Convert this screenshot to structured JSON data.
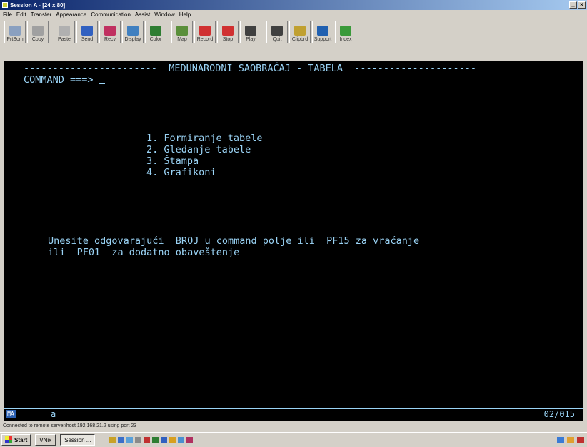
{
  "window": {
    "title": "Session A - [24 x 80]",
    "min_glyph": "_",
    "close_glyph": "×"
  },
  "menu": [
    "File",
    "Edit",
    "Transfer",
    "Appearance",
    "Communication",
    "Assist",
    "Window",
    "Help"
  ],
  "toolbar": [
    {
      "label": "PrtScrn",
      "icon": "print-screen-icon",
      "color": "#8aa0c0"
    },
    {
      "label": "Copy",
      "icon": "copy-icon",
      "color": "#a0a0a0"
    },
    {
      "label": "Paste",
      "icon": "paste-icon",
      "color": "#b0b0b0"
    },
    {
      "label": "Send",
      "icon": "send-icon",
      "color": "#3060c0"
    },
    {
      "label": "Recv",
      "icon": "receive-icon",
      "color": "#c03060"
    },
    {
      "label": "Display",
      "icon": "display-icon",
      "color": "#4080c0"
    },
    {
      "label": "Color",
      "icon": "color-icon",
      "color": "#2e7d32"
    },
    {
      "label": "Map",
      "icon": "map-icon",
      "color": "#5a8f3a"
    },
    {
      "label": "Record",
      "icon": "record-icon",
      "color": "#d03030"
    },
    {
      "label": "Stop",
      "icon": "stop-icon",
      "color": "#d03030"
    },
    {
      "label": "Play",
      "icon": "play-icon",
      "color": "#404040"
    },
    {
      "label": "Quit",
      "icon": "quit-icon",
      "color": "#404040"
    },
    {
      "label": "Clipbrd",
      "icon": "clipboard-icon",
      "color": "#c0a030"
    },
    {
      "label": "Support",
      "icon": "support-icon",
      "color": "#2060b0"
    },
    {
      "label": "Index",
      "icon": "index-icon",
      "color": "#3a9a3a"
    }
  ],
  "screen": {
    "header": "-----------------------  MEDUNARODNI SAOBRAĆAJ - TABELA  ---------------------",
    "command_prompt": "COMMAND ===>",
    "menu_items": [
      "1. Formiranje tabele",
      "2. Gledanje tabele",
      "3. Štampa",
      "4. Grafikoni"
    ],
    "instruction_1": "Unesite odgovarajući  BROJ u command polje ili  PF15 za vraćanje",
    "instruction_2": "ili  PF01  za dodatno obaveštenje"
  },
  "oia": {
    "indicator": "MA",
    "session": "a",
    "cursor_pos": "02/015"
  },
  "status": "Connected to remote server/host 192.168.21.2 using port 23",
  "taskbar": {
    "start": "Start",
    "items": [
      "VNix",
      "Session ..."
    ]
  },
  "colors": {
    "terminal_bg": "#000000",
    "terminal_fg": "#9ad3f5",
    "titlebar": "#0a246a"
  }
}
